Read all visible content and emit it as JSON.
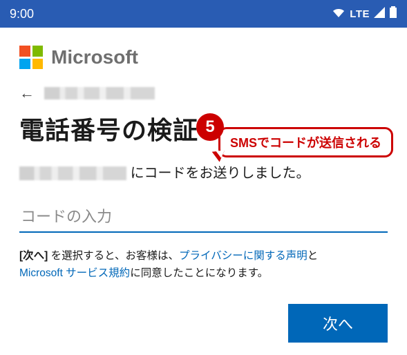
{
  "status": {
    "time": "9:00",
    "network_label": "LTE"
  },
  "brand": {
    "name": "Microsoft"
  },
  "page": {
    "title": "電話番号の検証",
    "sent_suffix": "にコードをお送りしました。"
  },
  "input": {
    "placeholder": "コードの入力"
  },
  "consent": {
    "prefix": "[次へ]",
    "after_prefix": " を選択すると、お客様は、",
    "privacy_link": "プライバシーに関する声明",
    "and_text": "と",
    "tos_link": "Microsoft サービス規約",
    "suffix": "に同意したことになります。"
  },
  "actions": {
    "next": "次へ"
  },
  "annotation": {
    "step_number": "5",
    "text": "SMSでコードが送信される"
  }
}
